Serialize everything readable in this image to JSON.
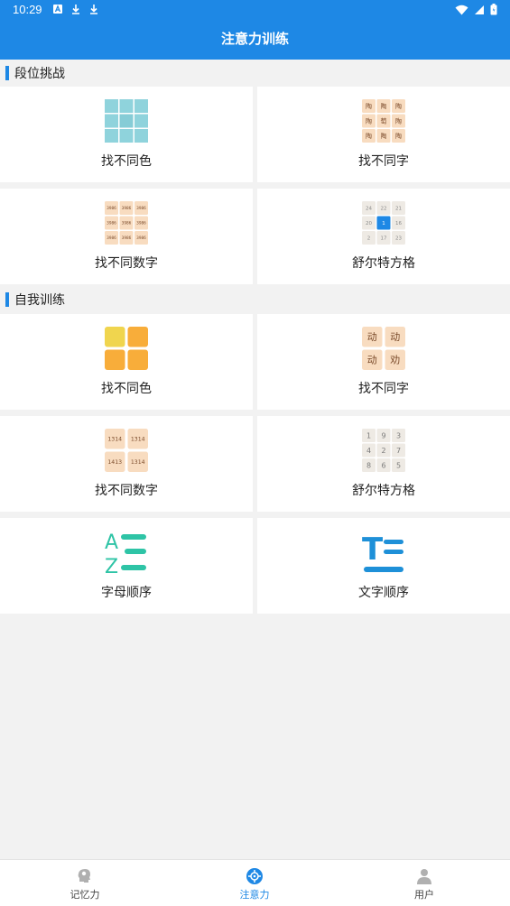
{
  "status_bar": {
    "time": "10:29"
  },
  "app_bar": {
    "title": "注意力训练"
  },
  "sections": [
    {
      "title": "段位挑战"
    },
    {
      "title": "自我训练"
    }
  ],
  "cards": {
    "c1": {
      "label": "找不同色"
    },
    "c2": {
      "label": "找不同字",
      "glyphs": [
        "陶",
        "陶",
        "陶",
        "陶",
        "萄",
        "陶",
        "陶",
        "陶",
        "陶"
      ]
    },
    "c3": {
      "label": "找不同数字",
      "nums": [
        "3986",
        "3986",
        "3986",
        "3986",
        "3986",
        "3986",
        "3986",
        "3986",
        "3986"
      ]
    },
    "c4": {
      "label": "舒尔特方格",
      "nums": [
        "24",
        "22",
        "21",
        "20",
        "1",
        "16",
        "2",
        "17",
        "23"
      ]
    },
    "c5": {
      "label": "找不同色"
    },
    "c6": {
      "label": "找不同字",
      "glyphs": [
        "动",
        "动",
        "动",
        "劝"
      ]
    },
    "c7": {
      "label": "找不同数字",
      "nums": [
        "1314",
        "1314",
        "1413",
        "1314"
      ]
    },
    "c8": {
      "label": "舒尔特方格",
      "nums": [
        "1",
        "9",
        "3",
        "4",
        "2",
        "7",
        "8",
        "6",
        "5"
      ]
    },
    "c9": {
      "label": "字母顺序",
      "letters": [
        "A",
        "Z"
      ]
    },
    "c10": {
      "label": "文字顺序",
      "letter": "T"
    }
  },
  "bottom_nav": {
    "items": [
      {
        "label": "记忆力"
      },
      {
        "label": "注意力"
      },
      {
        "label": "用户"
      }
    ]
  },
  "colors": {
    "accent": "#1e88e5",
    "teal": "#8fd3dc",
    "orange": "#f8ad3a",
    "yellow": "#f0d54e",
    "peach": "#f8dcc0",
    "green_teal": "#2ec4a6",
    "blue": "#1e90d8"
  }
}
